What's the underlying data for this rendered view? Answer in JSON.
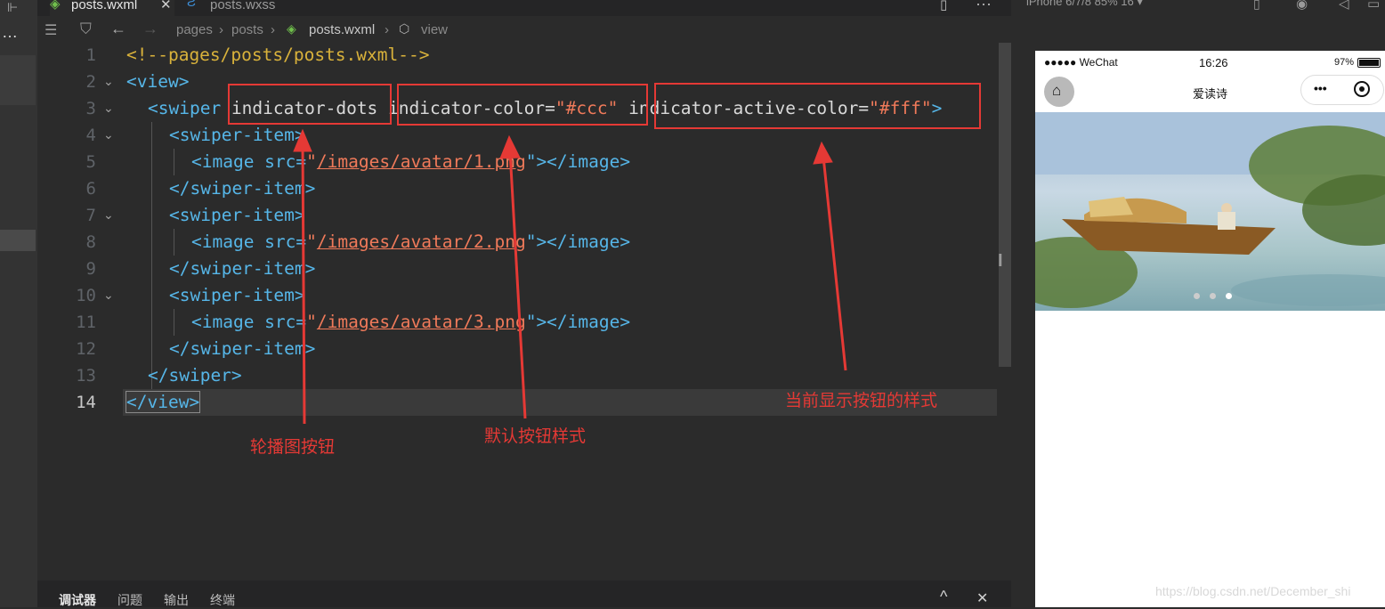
{
  "tabs": [
    {
      "label": "posts.wxml",
      "icon": "wxml-file-icon",
      "close": "✕"
    },
    {
      "label": "posts.wxss",
      "icon": "wxss-file-icon"
    }
  ],
  "breadcrumb": {
    "items": [
      "pages",
      "posts",
      "posts.wxml",
      "view"
    ],
    "separator": "›"
  },
  "editor": {
    "lines": [
      {
        "num": "1"
      },
      {
        "num": "2"
      },
      {
        "num": "3"
      },
      {
        "num": "4"
      },
      {
        "num": "5"
      },
      {
        "num": "6"
      },
      {
        "num": "7"
      },
      {
        "num": "8"
      },
      {
        "num": "9"
      },
      {
        "num": "10"
      },
      {
        "num": "11"
      },
      {
        "num": "12"
      },
      {
        "num": "13"
      },
      {
        "num": "14"
      }
    ],
    "code": {
      "l1": "<!--pages/posts/posts.wxml-->",
      "view_open": "<view>",
      "swiper_open": "<swiper",
      "attr_dots": "indicator-dots",
      "attr_color_name": "indicator-color=",
      "attr_color_val": "\"#ccc\"",
      "attr_active_name": "indicator-active-color=",
      "attr_active_val": "\"#fff\"",
      "gt": ">",
      "swiper_item_open": "<swiper-item>",
      "image_open": "<image src=",
      "q": "\"",
      "src1": "/images/avatar/1.png",
      "src2": "/images/avatar/2.png",
      "src3": "/images/avatar/3.png",
      "image_close": "\"></image>",
      "swiper_item_close": "</swiper-item>",
      "swiper_close": "</swiper>",
      "view_close": "</view>"
    }
  },
  "annotations": {
    "dots_label": "轮播图按钮",
    "color_label": "默认按钮样式",
    "active_label": "当前显示按钮的样式",
    "color": "#e53935"
  },
  "bottom_panel": {
    "tabs": [
      "调试器",
      "问题",
      "输出",
      "终端"
    ],
    "collapse_icon": "^",
    "close_icon": "✕"
  },
  "simulator": {
    "device_label": "iPhone 6/7/8 85% 16 ▾",
    "status": {
      "carrier": "●●●●● WeChat",
      "time": "16:26",
      "battery": "97%"
    },
    "nav_title": "爱读诗",
    "capsule_more": "•••",
    "swiper_dots": 3,
    "active_dot": 2
  },
  "watermark": "https://blog.csdn.net/December_shi"
}
